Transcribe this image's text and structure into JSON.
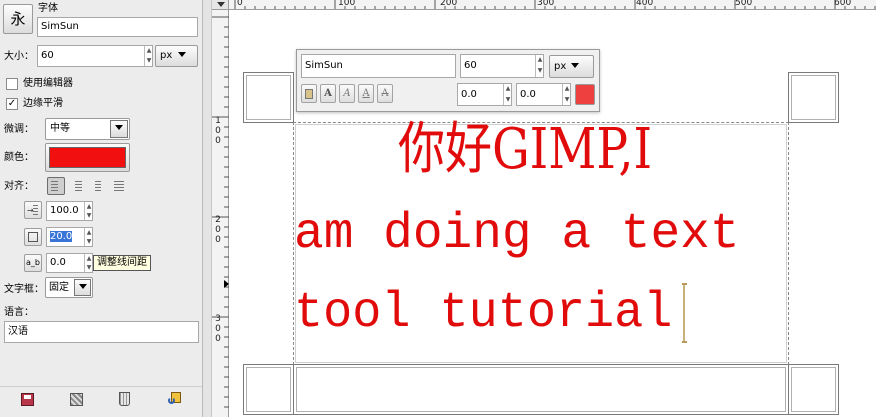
{
  "panel": {
    "font_label": "字体",
    "font_preview_glyph": "永",
    "font_value": "SimSun",
    "size_label": "大小：",
    "size_value": "60",
    "size_unit": "px",
    "use_editor_label": "使用编辑器",
    "use_editor_checked": false,
    "antialias_label": "边缘平滑",
    "antialias_checked": true,
    "hinting_label": "微调：",
    "hinting_value": "中等",
    "color_label": "颜色：",
    "color_value": "#f20f0f",
    "justify_label": "对齐：",
    "indent_value": "100.0",
    "line_spacing_value": "20.0",
    "letter_spacing_value": "0.0",
    "letter_spacing_icon_text": "a_b",
    "tooltip": "调整线间距",
    "box_label": "文字框：",
    "box_value": "固定",
    "language_label": "语言：",
    "language_value": "汉语",
    "bottom_icons": [
      "save-icon",
      "restore-icon",
      "delete-icon",
      "reset-icon"
    ]
  },
  "rulers": {
    "horizontal": [
      "0",
      "100",
      "200",
      "300",
      "400",
      "500",
      "600"
    ],
    "vertical": [
      [
        "1",
        "0",
        "0"
      ],
      [
        "2",
        "0",
        "0"
      ],
      [
        "3",
        "0",
        "0"
      ]
    ]
  },
  "canvas": {
    "line1": "你好GIMP,I",
    "line2": "am doing a text",
    "line3": "tool tutorial",
    "text_color": "#e10b0b"
  },
  "style_editor": {
    "font_value": "SimSun",
    "size_value": "60",
    "size_unit": "px",
    "baseline_value": "0.0",
    "kerning_value": "0.0",
    "color_value": "#ef4040",
    "style_buttons": [
      "A",
      "A",
      "A",
      "A"
    ]
  }
}
